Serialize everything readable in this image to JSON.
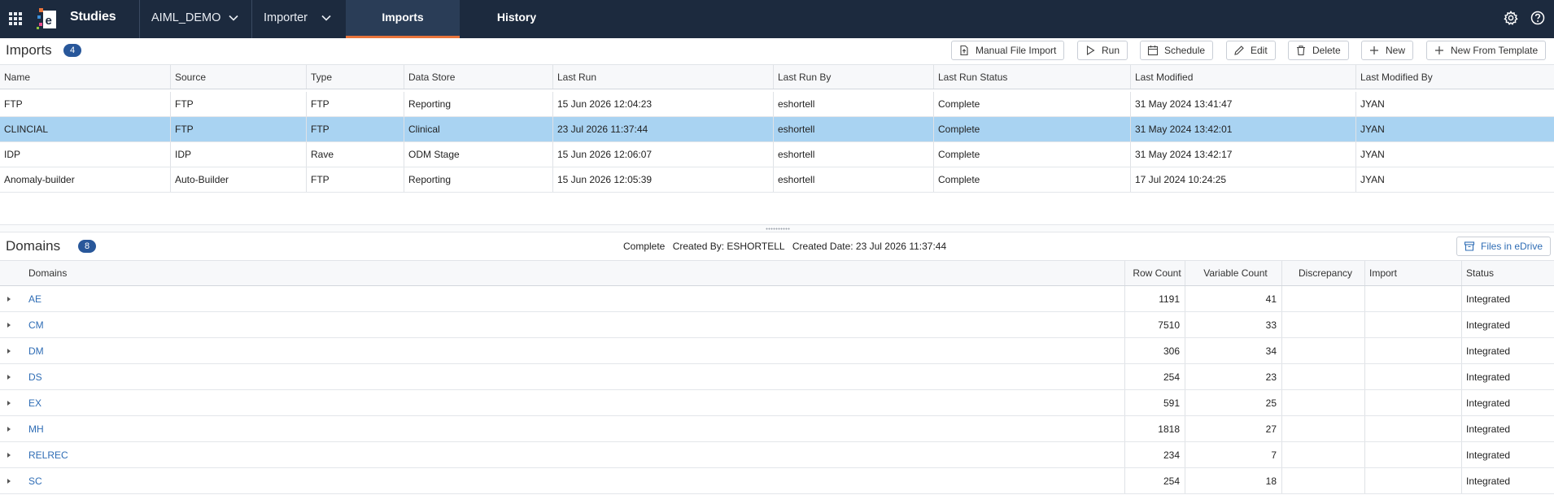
{
  "topbar": {
    "brand": "Studies",
    "study": "AIML_DEMO",
    "module": "Importer",
    "tabs": [
      {
        "label": "Imports",
        "active": true
      },
      {
        "label": "History",
        "active": false
      }
    ],
    "icons": [
      "apps-grid-icon",
      "settings-gear-icon",
      "help-icon"
    ],
    "colors": {
      "bar": "#1c2a3e",
      "active_tab": "#2a3d57",
      "accent": "#e8743b"
    }
  },
  "imports": {
    "title": "Imports",
    "count": "4",
    "toolbar": [
      {
        "label": "Manual File Import",
        "icon": "file-upload-icon"
      },
      {
        "label": "Run",
        "icon": "play-icon"
      },
      {
        "label": "Schedule",
        "icon": "calendar-icon"
      },
      {
        "label": "Edit",
        "icon": "pencil-icon"
      },
      {
        "label": "Delete",
        "icon": "trash-icon"
      },
      {
        "label": "New",
        "icon": "plus-icon"
      },
      {
        "label": "New From Template",
        "icon": "plus-icon"
      }
    ],
    "columns": [
      "Name",
      "Source",
      "Type",
      "Data Store",
      "Last Run",
      "Last Run By",
      "Last Run Status",
      "Last Modified",
      "Last Modified By"
    ],
    "rows": [
      {
        "cells": [
          "FTP",
          "FTP",
          "FTP",
          "Reporting",
          "15 Jun 2026 12:04:23",
          "eshortell",
          "Complete",
          "31 May 2024 13:41:47",
          "JYAN"
        ],
        "selected": false
      },
      {
        "cells": [
          "CLINCIAL",
          "FTP",
          "FTP",
          "Clinical",
          "23 Jul 2026 11:37:44",
          "eshortell",
          "Complete",
          "31 May 2024 13:42:01",
          "JYAN"
        ],
        "selected": true
      },
      {
        "cells": [
          "IDP",
          "IDP",
          "Rave",
          "ODM Stage",
          "15 Jun 2026 12:06:07",
          "eshortell",
          "Complete",
          "31 May 2024 13:42:17",
          "JYAN"
        ],
        "selected": false
      },
      {
        "cells": [
          "Anomaly-builder",
          "Auto-Builder",
          "FTP",
          "Reporting",
          "15 Jun 2026 12:05:39",
          "eshortell",
          "Complete",
          "17 Jul 2024 10:24:25",
          "JYAN"
        ],
        "selected": false
      }
    ],
    "selected_color": "#a9d3f2"
  },
  "domains": {
    "title": "Domains",
    "count": "8",
    "status_text": "Complete",
    "created_by": "Created By: ESHORTELL",
    "created_date": "Created Date: 23 Jul 2026 11:37:44",
    "files_button": "Files in eDrive",
    "columns": [
      "Domains",
      "Row Count",
      "Variable Count",
      "Discrepancy",
      "Import",
      "Status"
    ],
    "rows": [
      {
        "name": "AE",
        "row_count": "1191",
        "variable_count": "41",
        "discrepancy": "",
        "import": "",
        "status": "Integrated"
      },
      {
        "name": "CM",
        "row_count": "7510",
        "variable_count": "33",
        "discrepancy": "",
        "import": "",
        "status": "Integrated"
      },
      {
        "name": "DM",
        "row_count": "306",
        "variable_count": "34",
        "discrepancy": "",
        "import": "",
        "status": "Integrated"
      },
      {
        "name": "DS",
        "row_count": "254",
        "variable_count": "23",
        "discrepancy": "",
        "import": "",
        "status": "Integrated"
      },
      {
        "name": "EX",
        "row_count": "591",
        "variable_count": "25",
        "discrepancy": "",
        "import": "",
        "status": "Integrated"
      },
      {
        "name": "MH",
        "row_count": "1818",
        "variable_count": "27",
        "discrepancy": "",
        "import": "",
        "status": "Integrated"
      },
      {
        "name": "RELREC",
        "row_count": "234",
        "variable_count": "7",
        "discrepancy": "",
        "import": "",
        "status": "Integrated"
      },
      {
        "name": "SC",
        "row_count": "254",
        "variable_count": "18",
        "discrepancy": "",
        "import": "",
        "status": "Integrated"
      }
    ]
  }
}
